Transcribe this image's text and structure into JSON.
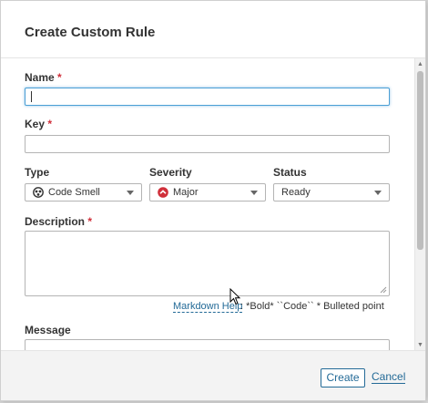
{
  "dialog": {
    "title": "Create Custom Rule"
  },
  "fields": {
    "name": {
      "label": "Name",
      "required_mark": "*",
      "value": ""
    },
    "key": {
      "label": "Key",
      "required_mark": "*",
      "value": ""
    },
    "type": {
      "label": "Type",
      "value": "Code Smell",
      "icon": "code-smell-icon"
    },
    "severity": {
      "label": "Severity",
      "value": "Major",
      "icon": "major-severity-icon"
    },
    "status": {
      "label": "Status",
      "value": "Ready"
    },
    "description": {
      "label": "Description",
      "required_mark": "*",
      "value": ""
    },
    "message": {
      "label": "Message",
      "value": ""
    }
  },
  "markdown": {
    "help_link": "Markdown Help",
    "hints": ": *Bold* ``Code`` * Bulleted point"
  },
  "footer": {
    "create_label": "Create",
    "cancel_label": "Cancel"
  },
  "colors": {
    "accent": "#236a97",
    "required": "#d02f3a",
    "severity_major": "#d02f3a",
    "focus_border": "#4b9fd5"
  }
}
